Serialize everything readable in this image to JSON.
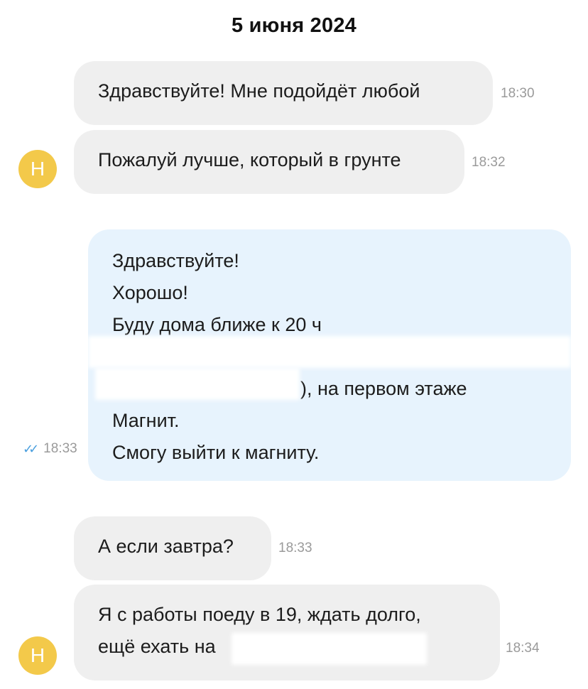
{
  "date_header": "5 июня 2024",
  "avatar_letter": "Н",
  "messages": [
    {
      "text": "Здравствуйте! Мне подойдёт любой",
      "time": "18:30"
    },
    {
      "text": "Пожалуй лучше, который в грунте",
      "time": "18:32"
    },
    {
      "lines": [
        "Здравствуйте!",
        "Хорошо!",
        "Буду дома ближе к 20 ч",
        "",
        "), на первом этаже",
        "Магнит.",
        "Смогу выйти к магниту."
      ],
      "time": "18:33"
    },
    {
      "text": "А если завтра?",
      "time": "18:33"
    },
    {
      "lines": [
        "Я с работы поеду в 19, ждать долго,",
        "ещё ехать на"
      ],
      "time": "18:34"
    }
  ],
  "colors": {
    "incoming_bubble": "#efefef",
    "outgoing_bubble": "#e7f3fd",
    "avatar": "#f3c94a",
    "read_check": "#4a9fde"
  }
}
